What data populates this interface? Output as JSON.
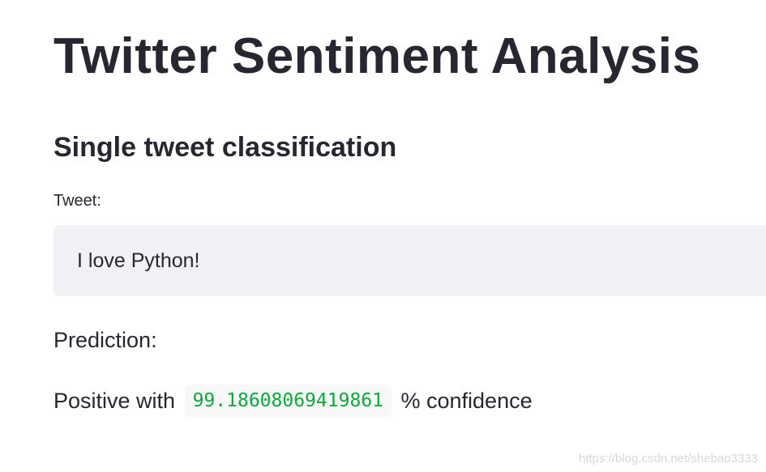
{
  "title": "Twitter Sentiment Analysis",
  "subheader": "Single tweet classification",
  "tweet": {
    "label": "Tweet:",
    "value": "I love Python!"
  },
  "prediction_label": "Prediction:",
  "result": {
    "prefix": "Positive with",
    "confidence": "99.18608069419861",
    "suffix": "% confidence",
    "code_color": "#09ab3b"
  },
  "watermark": "https://blog.csdn.net/shebao3333"
}
